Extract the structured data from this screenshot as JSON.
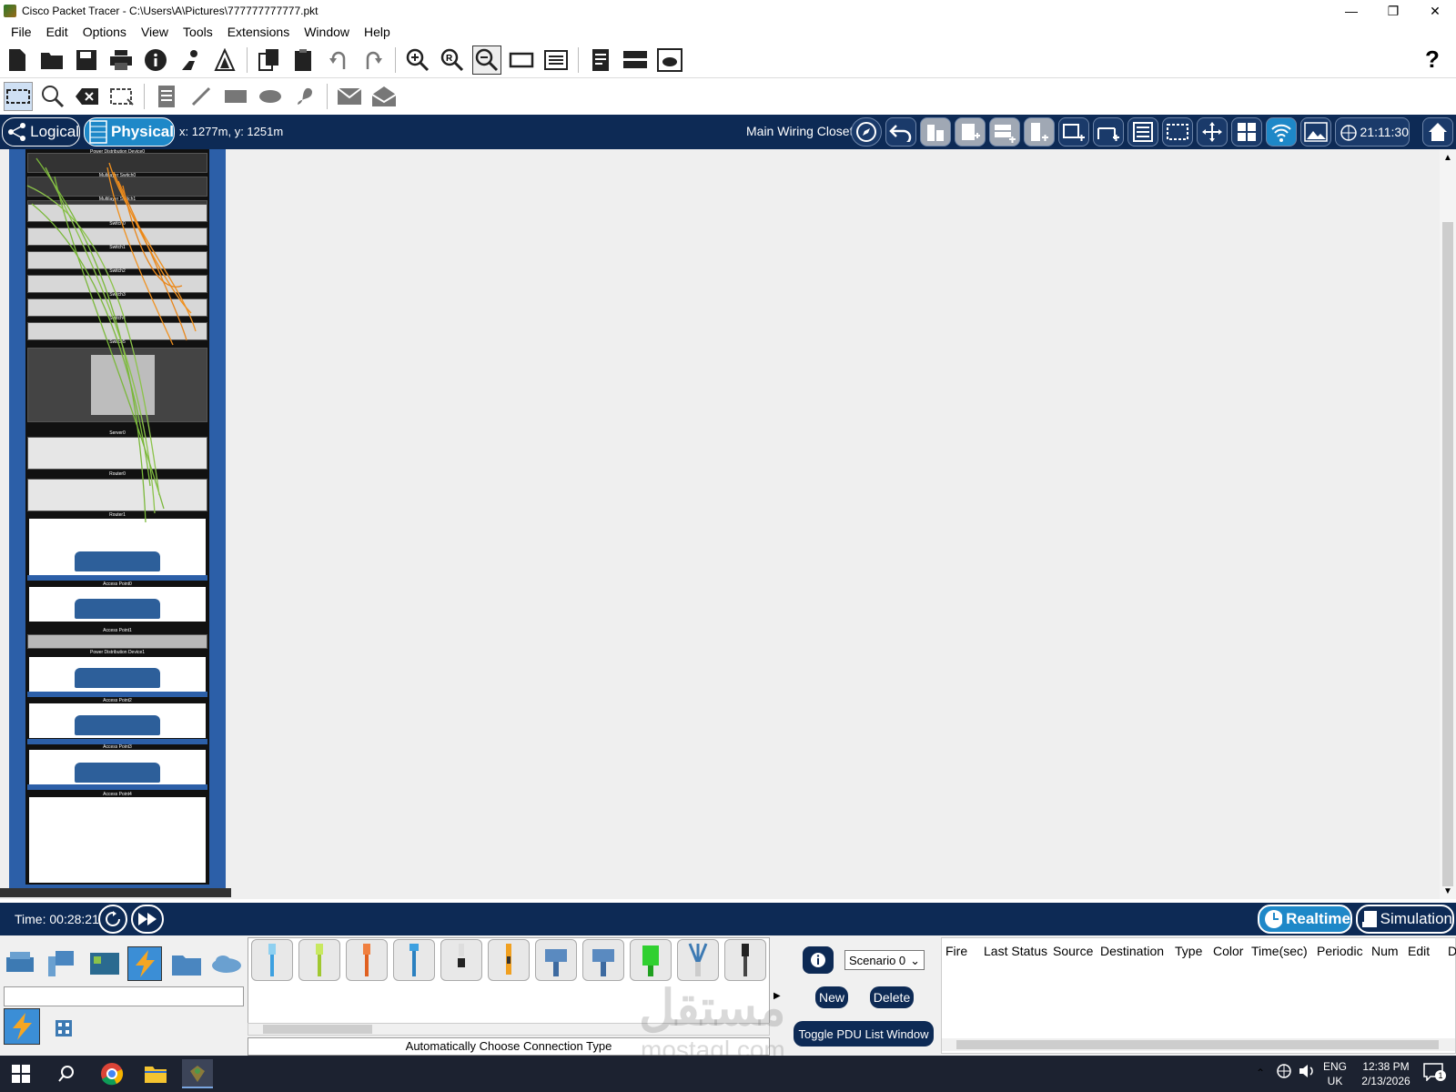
{
  "window": {
    "title": "Cisco Packet Tracer - C:\\Users\\A\\Pictures\\777777777777.pkt"
  },
  "menu": [
    "File",
    "Edit",
    "Options",
    "View",
    "Tools",
    "Extensions",
    "Window",
    "Help"
  ],
  "nav": {
    "logical_label": "Logical",
    "physical_label": "Physical",
    "coords": "x: 1277m, y: 1251m",
    "location": "Main Wiring Closet",
    "clock": "21:11:30"
  },
  "rack": {
    "labels": [
      "Power Distribution Device0",
      "Multilayer Switch0",
      "Multilayer Switch1",
      "Switch0",
      "Switch1",
      "Switch2",
      "Switch3",
      "Switch4",
      "Switch5",
      "Server0",
      "Router0",
      "Router1",
      "Access Point0",
      "Access Point1",
      "Power Distribution Device1",
      "Access Point2",
      "Access Point3",
      "Access Point4"
    ]
  },
  "time": {
    "label": "Time: 00:28:21",
    "realtime": "Realtime",
    "simulation": "Simulation"
  },
  "bottom": {
    "connection_status": "Automatically Choose Connection Type",
    "scenario": "Scenario 0",
    "new": "New",
    "delete": "Delete",
    "toggle": "Toggle PDU List Window",
    "columns": [
      "Fire",
      "Last Status",
      "Source",
      "Destination",
      "Type",
      "Color",
      "Time(sec)",
      "Periodic",
      "Num",
      "Edit",
      "D"
    ]
  },
  "taskbar": {
    "lang1": "ENG",
    "lang2": "UK",
    "time": "12:38 PM",
    "date": "2/13/2026",
    "notif": "1"
  },
  "watermark": {
    "arabic": "مستقل",
    "latin": "mostaql.com"
  }
}
